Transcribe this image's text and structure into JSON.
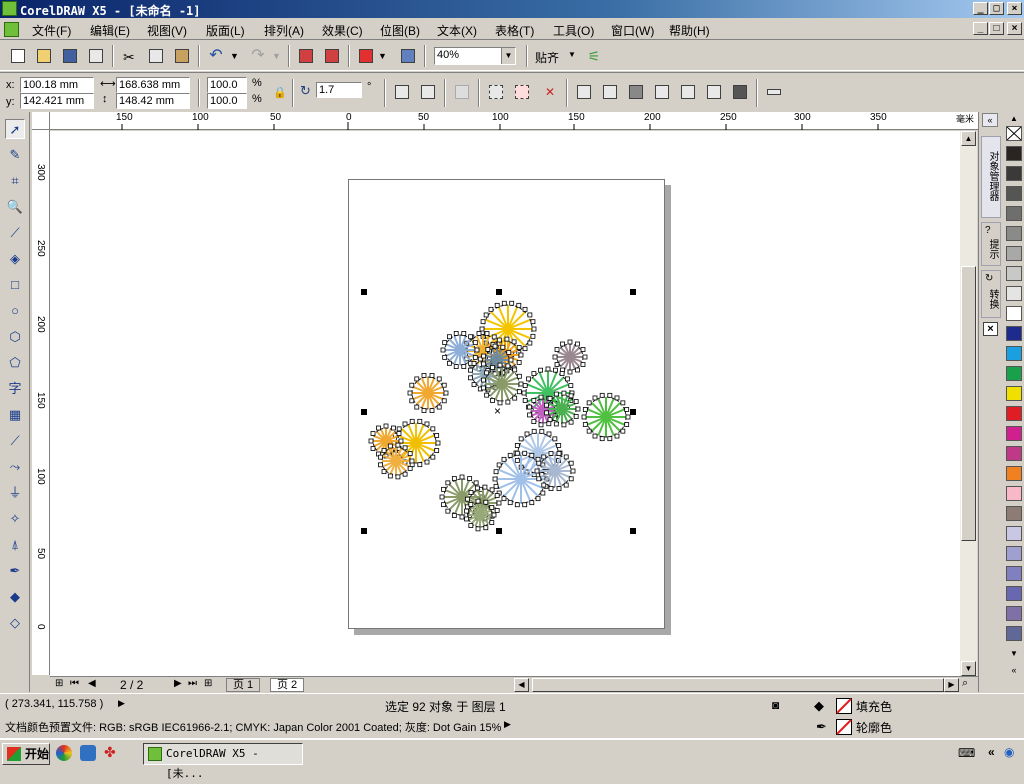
{
  "window": {
    "title": "CorelDRAW X5 - [未命名 -1]"
  },
  "menu": [
    "文件(F)",
    "编辑(E)",
    "视图(V)",
    "版面(L)",
    "排列(A)",
    "效果(C)",
    "位图(B)",
    "文本(X)",
    "表格(T)",
    "工具(O)",
    "窗口(W)",
    "帮助(H)"
  ],
  "toolbar": {
    "zoom": "40%",
    "snap_label": "贴齐"
  },
  "propbar": {
    "x": "100.18 mm",
    "y": "142.421 mm",
    "w": "168.638 mm",
    "h": "148.42 mm",
    "sx": "100.0",
    "sy": "100.0",
    "pct": "%",
    "rotation": "1.7",
    "deg": "°",
    "x_label": "x:",
    "y_label": "y:"
  },
  "ruler": {
    "unit": "毫米",
    "h_ticks": [
      "150",
      "100",
      "50",
      "0",
      "50",
      "100",
      "150",
      "200",
      "250",
      "300",
      "350"
    ],
    "v_ticks": [
      "300",
      "250",
      "200",
      "150",
      "100",
      "50",
      "0"
    ]
  },
  "pages": {
    "counter": "2 / 2",
    "tabs": [
      "页 1",
      "页 2"
    ],
    "active": 1
  },
  "status": {
    "coords": "( 273.341, 115.758 )",
    "selection": "选定 92 对象 于 图层 1",
    "fill_label": "填充色",
    "outline_label": "轮廓色",
    "color_profile": "文档颜色预置文件: RGB: sRGB IEC61966-2.1; CMYK: Japan Color 2001 Coated; 灰度: Dot Gain 15%"
  },
  "dockers": {
    "object_manager": "对象管理器",
    "hints": "提示",
    "transform": "转换"
  },
  "taskbar": {
    "start": "开始",
    "app": "CorelDRAW X5 - [未..."
  },
  "palette": [
    "#ffffff",
    "#2a2422",
    "#3c3a38",
    "#555553",
    "#6e6e6c",
    "#8a8a88",
    "#a8a8a6",
    "#c8c8c6",
    "#e4e4e2",
    "#ffffff",
    "#1e2a8c",
    "#1aa0e0",
    "#18a04a",
    "#f0e000",
    "#e01c24",
    "#d02090",
    "#c03888",
    "#f08020",
    "#f8b8c8",
    "#8c7c74",
    "#c8c8e4",
    "#a0a0d0",
    "#8080c0",
    "#6868b0",
    "#8070a8",
    "#606898"
  ]
}
